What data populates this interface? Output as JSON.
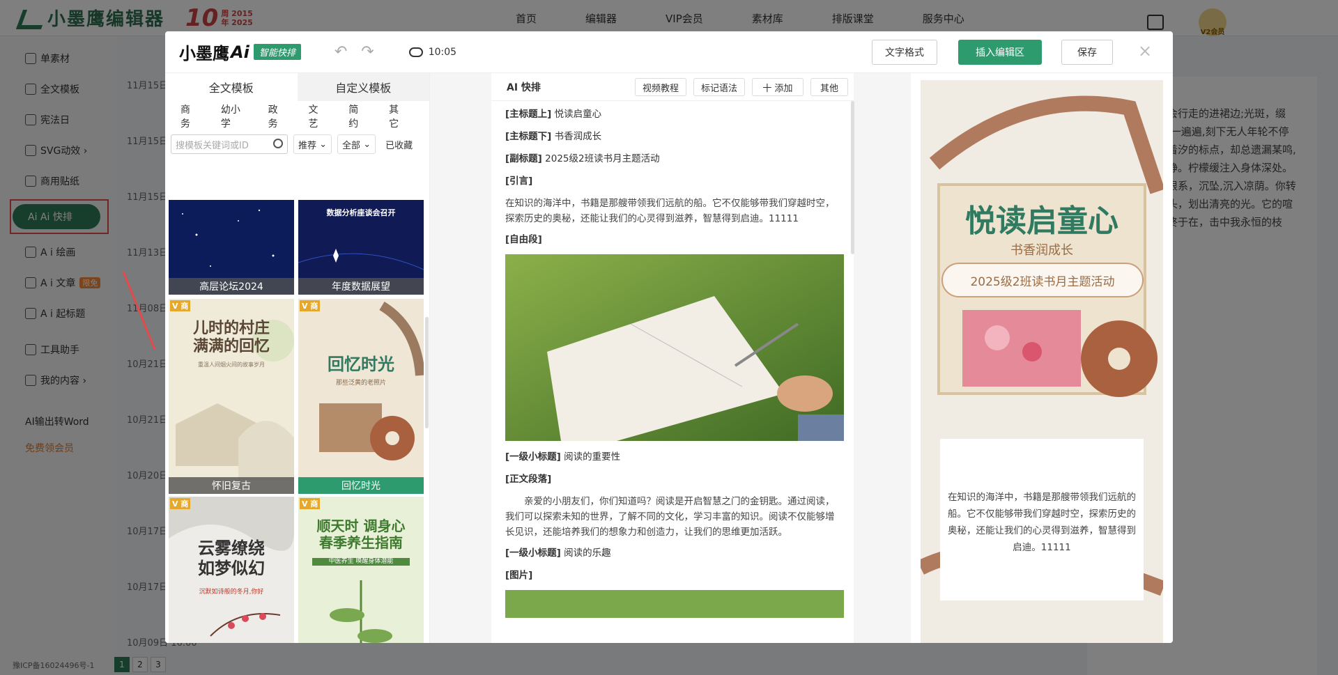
{
  "app": {
    "logo_text": "小墨鹰编辑器",
    "anniv_big": "10",
    "anniv_small_1": "周 2015",
    "anniv_small_2": "年 2025",
    "nav": [
      "首页",
      "编辑器",
      "VIP会员",
      "素材库",
      "排版课堂",
      "服务中心"
    ],
    "vip_badge": "V2会员"
  },
  "sidebar": {
    "items": [
      {
        "label": "单素材"
      },
      {
        "label": "全文模板"
      },
      {
        "label": "宪法日"
      },
      {
        "label": "SVG动效 ›"
      },
      {
        "label": "商用贴纸"
      }
    ],
    "active_label": "Ai Ai 快排",
    "items2": [
      {
        "label": "A i 绘画"
      },
      {
        "label": "A i 文章"
      },
      {
        "label": "A i 起标题"
      },
      {
        "label": "工具助手"
      },
      {
        "label": "我的内容 ›"
      }
    ],
    "new_badge": "限免",
    "word_link": "AI输出转Word",
    "free_vip": "免费领会员",
    "icp": "豫ICP备16024496号-1",
    "pages": [
      "1",
      "2",
      "3"
    ]
  },
  "background": {
    "rows": [
      "11月15日",
      "11月15日",
      "11月15日",
      "11月13日",
      "11月08日",
      "10月21日",
      "10月21日",
      "10月20日",
      "10月17日",
      "10月17日",
      "10月09日 16:00"
    ],
    "right_text": "把自己种成会行走的进裙边;光斑，缀上袖铁栏杆,一遍遍,刻下无人年轮不停旋转。我数着汐的标点，却总遗漏某鸣,那尖锐的寂静。柠檬缓注入身体深处。气泡，我的根系，沉坠,沉入凉荫。你转身时，一粒头，划出清亮的光。它的喧嚣与尘埃，终于在，击中我永恒的枝干。"
  },
  "modal": {
    "logo": "小墨鹰",
    "logo_ai": "Ai",
    "tag": "智能快排",
    "time": "10:05",
    "btn_format": "文字格式",
    "btn_insert": "插入编辑区",
    "btn_save": "保存",
    "close": "×"
  },
  "templates": {
    "tabs": [
      "全文模板",
      "自定义模板"
    ],
    "categories": [
      "商务",
      "幼小学",
      "政务",
      "文艺",
      "简约",
      "其它"
    ],
    "search_placeholder": "搜模板关键词或ID",
    "sort": "推荐",
    "scope": "全部",
    "fav": "已收藏",
    "cards": [
      {
        "caption": "高层论坛2024",
        "vtag": ""
      },
      {
        "caption": "年度数据展望",
        "poster": "数据分析座谈会召开",
        "vtag": ""
      },
      {
        "caption": "怀旧复古",
        "poster": "儿时的村庄\n满满的回忆",
        "sub": "重温人间烟火间的故事岁月",
        "vtag": "V 商"
      },
      {
        "caption": "回忆时光",
        "poster": "回忆时光",
        "sub": "那些泛黄的老照片",
        "vtag": "V 商"
      },
      {
        "caption": "",
        "poster": "云雾缭绕\n如梦似幻",
        "sub": "沉默如诗般的冬月,你好",
        "vtag": "V 商"
      },
      {
        "caption": "",
        "poster": "顺天时 调身心\n春季养生指南",
        "sub": "中医养生 唤醒身体潜能",
        "vtag": "V 商"
      }
    ]
  },
  "editor": {
    "title": "AI 快排",
    "btn_video": "视频教程",
    "btn_mark": "标记语法",
    "btn_add": "十 添加",
    "btn_other": "其他",
    "lines": [
      {
        "tag": "[主标题上]",
        "text": " 悦读启童心"
      },
      {
        "tag": "[主标题下]",
        "text": " 书香润成长"
      },
      {
        "tag": "[副标题]",
        "text": " 2025级2班读书月主题活动"
      },
      {
        "tag": "[引言]",
        "text": ""
      }
    ],
    "intro": "在知识的海洋中，书籍是那艘带领我们远航的船。它不仅能够带我们穿越时空，探索历史的奥秘，还能让我们的心灵得到滋养，智慧得到启迪。11111",
    "free_tag": "[自由段]",
    "h1_tag": "[一级小标题]",
    "h1_text": " 阅读的重要性",
    "body_tag": "[正文段落]",
    "body": "亲爱的小朋友们，你们知道吗？阅读是开启智慧之门的金钥匙。通过阅读，我们可以探索未知的世界，了解不同的文化，学习丰富的知识。阅读不仅能够增长见识，还能培养我们的想象力和创造力，让我们的思维更加活跃。",
    "h2_tag": "[一级小标题]",
    "h2_text": " 阅读的乐趣",
    "img_tag": "[图片]"
  },
  "preview": {
    "title": "悦读启童心",
    "subtitle": "书香润成长",
    "box": "2025级2班读书月主题活动",
    "card_text": "在知识的海洋中，书籍是那艘带领我们远航的船。它不仅能够带我们穿越时空，探索历史的奥秘，还能让我们的心灵得到滋养，智慧得到启迪。11111"
  },
  "colors": {
    "brand_green": "#2e9b6e",
    "highlight_red": "#e24b4b"
  }
}
